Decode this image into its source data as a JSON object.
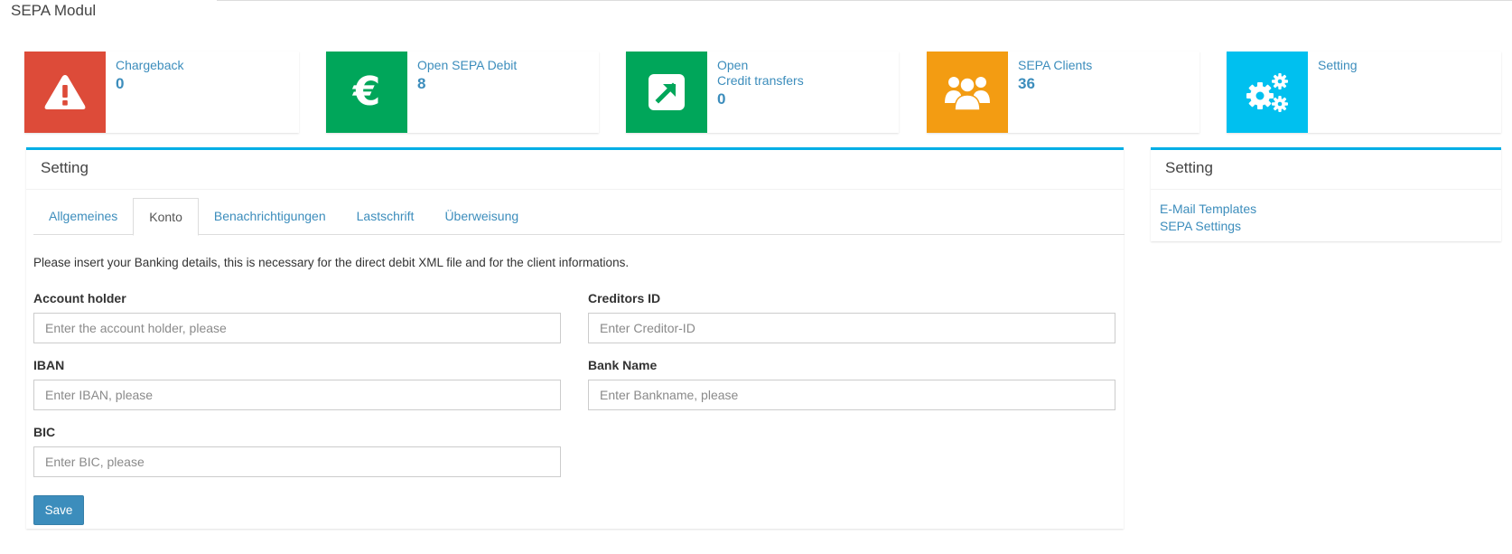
{
  "module_title": "SEPA Modul",
  "tiles": [
    {
      "label": "Chargeback",
      "label2": "",
      "value": "0",
      "icon": "warning-icon",
      "color": "#dd4b39"
    },
    {
      "label": "Open SEPA Debit",
      "label2": "",
      "value": "8",
      "icon": "euro-icon",
      "color": "#00a65a"
    },
    {
      "label": "Open",
      "label2": "Credit transfers",
      "value": "0",
      "icon": "external-link-icon",
      "color": "#00a65a"
    },
    {
      "label": "SEPA Clients",
      "label2": "",
      "value": "36",
      "icon": "users-icon",
      "color": "#f39c12"
    },
    {
      "label": "Setting",
      "label2": "",
      "value": "",
      "icon": "gears-icon",
      "color": "#00c0ef"
    }
  ],
  "main": {
    "title": "Setting",
    "tabs": [
      {
        "label": "Allgemeines",
        "active": false
      },
      {
        "label": "Konto",
        "active": true
      },
      {
        "label": "Benachrichtigungen",
        "active": false
      },
      {
        "label": "Lastschrift",
        "active": false
      },
      {
        "label": "Überweisung",
        "active": false
      }
    ],
    "intro": "Please insert your Banking details, this is necessary for the direct debit XML file and for the client informations.",
    "fields": {
      "account_holder": {
        "label": "Account holder",
        "placeholder": "Enter the account holder, please",
        "value": ""
      },
      "creditors_id": {
        "label": "Creditors ID",
        "placeholder": "Enter Creditor-ID",
        "value": ""
      },
      "iban": {
        "label": "IBAN",
        "placeholder": "Enter IBAN, please",
        "value": ""
      },
      "bank_name": {
        "label": "Bank Name",
        "placeholder": "Enter Bankname, please",
        "value": ""
      },
      "bic": {
        "label": "BIC",
        "placeholder": "Enter BIC, please",
        "value": ""
      }
    },
    "save_label": "Save"
  },
  "side": {
    "title": "Setting",
    "links": [
      "E-Mail Templates",
      "SEPA Settings"
    ]
  },
  "colors": {
    "accent": "#3c8dbc",
    "box_border": "#00aee6"
  }
}
